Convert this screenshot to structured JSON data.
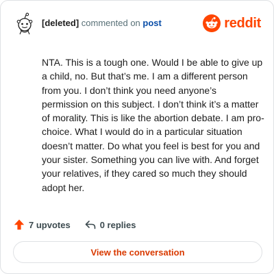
{
  "header": {
    "author": "[deleted]",
    "action": "commented on",
    "post_link": "post",
    "brand": "reddit"
  },
  "comment": {
    "text": "NTA. This is a tough one. Would I be able to give up a child, no. But that’s me. I am a different person from you. I don’t think you need anyone’s permission on this subject. I don’t think it’s a matter of morality. This is like the abortion debate. I am pro-choice. What I would do in a particular situation doesn’t matter. Do what you feel is best for you and your sister. Something you can live with. And forget your relatives, if they cared so much they should adopt her."
  },
  "footer": {
    "upvotes": "7 upvotes",
    "replies": "0 replies"
  },
  "cta": {
    "label": "View the conversation"
  },
  "colors": {
    "brand": "#ff4500",
    "cta_text": "#d93a00",
    "link": "#0a4ea8",
    "muted": "#576f76"
  }
}
